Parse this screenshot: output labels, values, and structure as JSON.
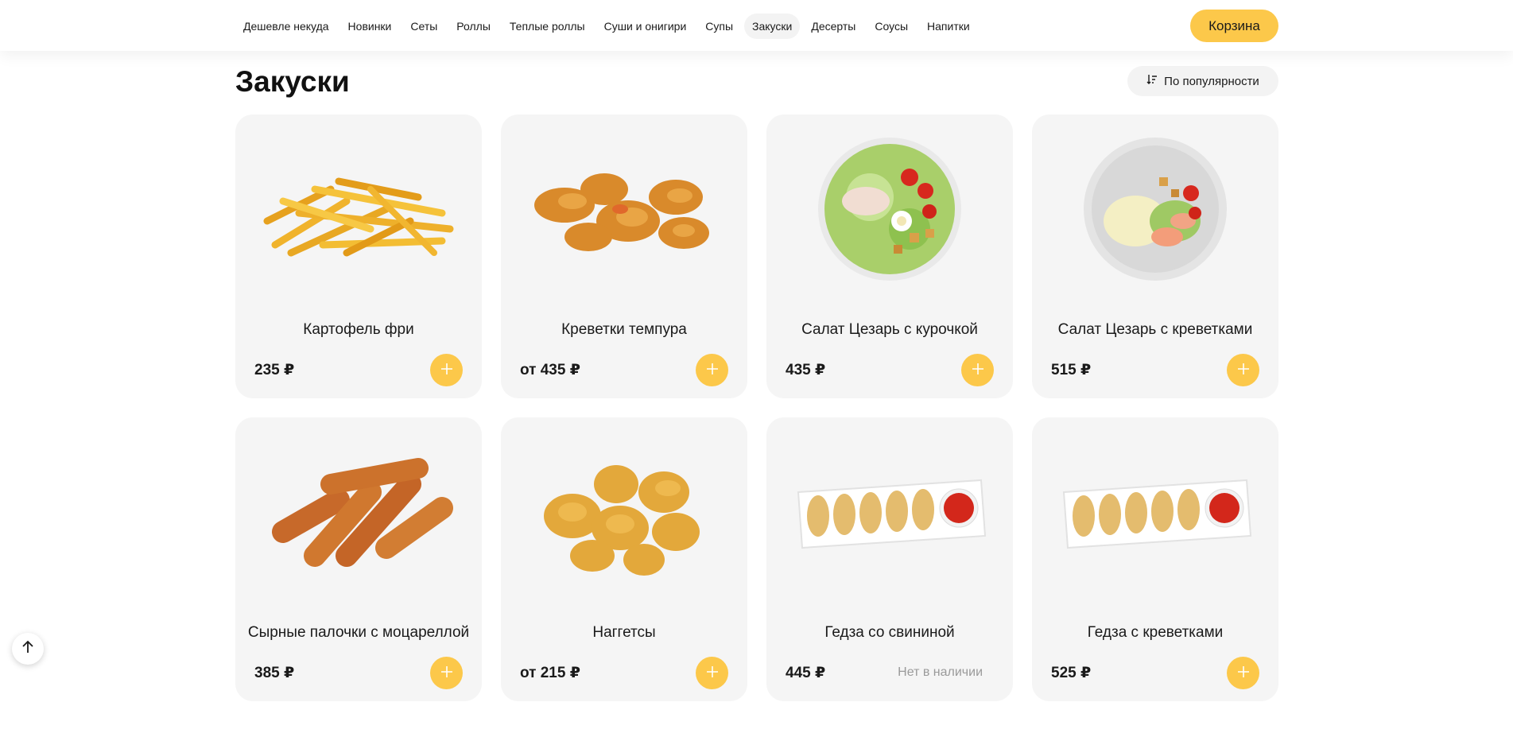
{
  "nav": {
    "items": [
      {
        "label": "Дешевле некуда"
      },
      {
        "label": "Новинки"
      },
      {
        "label": "Сеты"
      },
      {
        "label": "Роллы"
      },
      {
        "label": "Теплые роллы"
      },
      {
        "label": "Суши и онигири"
      },
      {
        "label": "Супы"
      },
      {
        "label": "Закуски",
        "active": true
      },
      {
        "label": "Десерты"
      },
      {
        "label": "Соусы"
      },
      {
        "label": "Напитки"
      }
    ],
    "cart_label": "Корзина"
  },
  "page": {
    "title": "Закуски",
    "sort_label": "По популярности",
    "sort_icon": "sort-icon"
  },
  "products": [
    {
      "name": "Картофель фри",
      "price": "235 ₽",
      "image": "fries-image",
      "available": true
    },
    {
      "name": "Креветки темпура",
      "price": "от 435 ₽",
      "image": "tempura-shrimp-image",
      "available": true
    },
    {
      "name": "Салат Цезарь с курочкой",
      "price": "435 ₽",
      "image": "caesar-chicken-image",
      "available": true
    },
    {
      "name": "Салат Цезарь с креветками",
      "price": "515 ₽",
      "image": "caesar-shrimp-image",
      "available": true
    },
    {
      "name": "Сырные палочки с моцареллой",
      "price": "385 ₽",
      "image": "cheese-sticks-image",
      "available": true
    },
    {
      "name": "Наггетсы",
      "price": "от 215 ₽",
      "image": "nuggets-image",
      "available": true
    },
    {
      "name": "Гедза со свининой",
      "price": "445 ₽",
      "image": "gyoza-pork-image",
      "available": false,
      "status": "Нет в наличии"
    },
    {
      "name": "Гедза с креветками",
      "price": "525 ₽",
      "image": "gyoza-shrimp-image",
      "available": true
    }
  ],
  "colors": {
    "accent": "#fcc84a",
    "card_bg": "#f5f5f5",
    "muted_text": "#9a9a9a"
  },
  "scroll_top_icon": "arrow-up-icon"
}
